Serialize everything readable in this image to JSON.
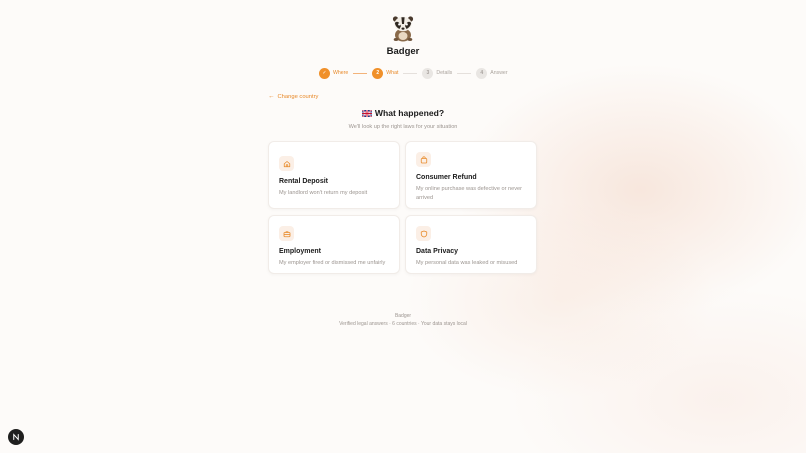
{
  "app": {
    "name": "Badger",
    "logo_icon": "badger-icon"
  },
  "stepper": {
    "steps": [
      {
        "badge": "✓",
        "label": "Where",
        "state": "done"
      },
      {
        "badge": "2",
        "label": "What",
        "state": "active"
      },
      {
        "badge": "3",
        "label": "Details",
        "state": "todo"
      },
      {
        "badge": "4",
        "label": "Answer",
        "state": "todo"
      }
    ]
  },
  "nav": {
    "change_country": "Change country",
    "back_icon": "arrow-left-icon"
  },
  "main": {
    "flag_icon": "uk-flag-icon",
    "title": "What happened?",
    "subtitle": "We'll look up the right laws for your situation"
  },
  "cards": [
    {
      "icon": "home-icon",
      "title": "Rental Deposit",
      "desc": "My landlord won't return my deposit"
    },
    {
      "icon": "shopping-bag-icon",
      "title": "Consumer Refund",
      "desc": "My online purchase was defective or never arrived"
    },
    {
      "icon": "briefcase-icon",
      "title": "Employment",
      "desc": "My employer fired or dismissed me unfairly"
    },
    {
      "icon": "shield-icon",
      "title": "Data Privacy",
      "desc": "My personal data was leaked or misused"
    }
  ],
  "footer": {
    "name": "Badger",
    "tagline": "Verified legal answers · 6 countries · Your data stays local"
  },
  "fab": {
    "icon": "n-logo-icon"
  },
  "colors": {
    "accent": "#f0902a",
    "muted": "#9c9590",
    "title": "#1b1b1b"
  }
}
